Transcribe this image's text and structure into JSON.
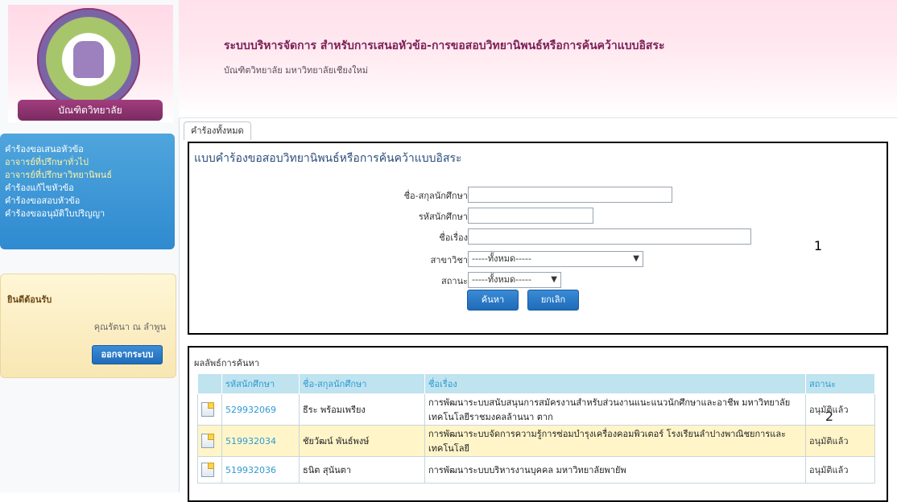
{
  "header": {
    "title": "ระบบบริหารจัดการ สำหรับการเสนอหัวข้อ-การขอสอบวิทยานิพนธ์หรือการค้นคว้าแบบอิสระ",
    "subtitle": "บัณฑิตวิทยาลัย มหาวิทยาลัยเชียงใหม่"
  },
  "sidebar": {
    "logo_text": "บัณฑิตวิทยาลัย",
    "menu": [
      {
        "label": "คำร้องขอเสนอหัวข้อ"
      },
      {
        "label": "อาจารย์ที่ปรึกษาทั่วไป"
      },
      {
        "label": "อาจารย์ที่ปรึกษาวิทยานิพนธ์"
      },
      {
        "label": "คำร้องแก้ไขหัวข้อ"
      },
      {
        "label": "คำร้องขอสอบหัวข้อ"
      },
      {
        "label": "คำร้องขออนุมัติใบปริญญา"
      }
    ],
    "welcome_title": "ยินดีต้อนรับ",
    "user_name": "คุณรัตนา ณ ลำพูน",
    "logout_label": "ออกจากระบบ"
  },
  "tabs": [
    {
      "label": "คำร้องทั้งหมด"
    }
  ],
  "search_panel": {
    "title": "แบบคำร้องขอสอบวิทยานิพนธ์หรือการค้นคว้าแบบอิสระ",
    "fields": {
      "student_name_label": "ชื่อ-สกุลนักศึกษา",
      "student_id_label": "รหัสนักศึกษา",
      "topic_label": "ชื่อเรื่อง",
      "major_label": "สาขาวิชา",
      "major_value": "-----ทั้งหมด-----",
      "status_label": "สถานะ",
      "status_value": "-----ทั้งหมด-----"
    },
    "buttons": {
      "search": "ค้นหา",
      "cancel": "ยกเลิก"
    },
    "annotation": "1"
  },
  "results_panel": {
    "title": "ผลลัพธ์การค้นหา",
    "annotation": "2",
    "columns": [
      "รหัสนักศึกษา",
      "ชื่อ-สกุลนักศึกษา",
      "ชื่อเรื่อง",
      "สถานะ"
    ],
    "rows": [
      {
        "id": "529932069",
        "name": "ธีระ พร้อมเพรียง",
        "topic": "การพัฒนาระบบสนับสนุนการสมัครงานสำหรับส่วนงานแนะแนวนักศึกษาและอาชีพ มหาวิทยาลัยเทคโนโลยีราชมงคลล้านนา ตาก",
        "status": "อนุมัติแล้ว"
      },
      {
        "id": "519932034",
        "name": "ชัยวัฒน์ พันธ์พงษ์",
        "topic": "การพัฒนาระบบจัดการความรู้การซ่อมบำรุงเครื่องคอมพิวเตอร์ โรงเรียนลำปางพาณิชยการและเทคโนโลยี",
        "status": "อนุมัติแล้ว"
      },
      {
        "id": "519932036",
        "name": "ธนิต สุนันตา",
        "topic": "การพัฒนาระบบบริหารงานบุคคล มหาวิทยาลัยพายัพ",
        "status": "อนุมัติแล้ว"
      }
    ]
  }
}
